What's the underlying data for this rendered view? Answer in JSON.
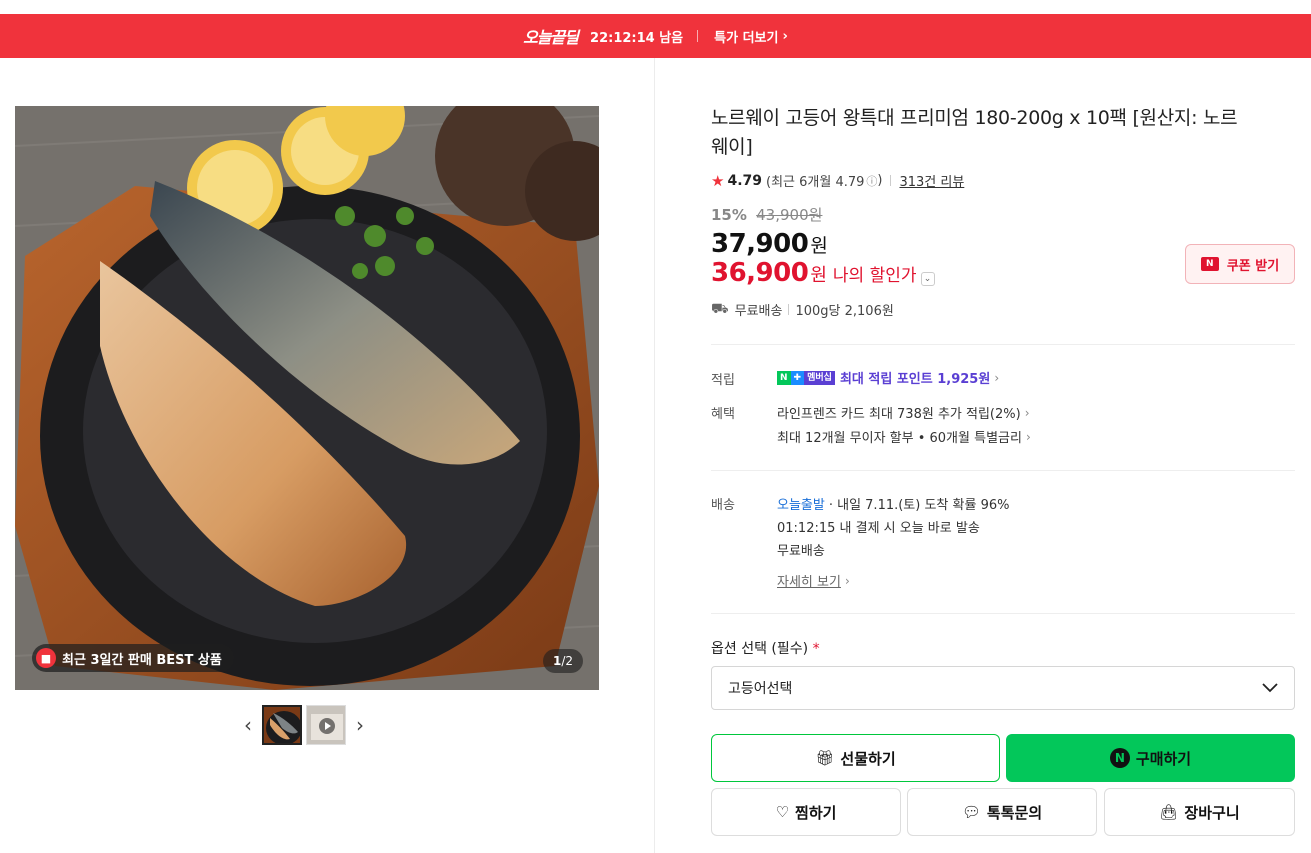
{
  "deal_bar": {
    "logo": "오늘끝딜",
    "timer": "22:12:14 남음",
    "more_label": "특가 더보기",
    "color": "#f0333c"
  },
  "gallery": {
    "best_badge": "최근 3일간 판매 BEST 상품",
    "counter_current": "1",
    "counter_total": "/2",
    "image_alt": "grilled-mackerel-on-cast-iron-plate"
  },
  "product": {
    "title": "노르웨이 고등어 왕특대 프리미엄 180-200g x 10팩 [원산지: 노르웨이]",
    "rating": "4.79",
    "rating_recent": "(최근 6개월 4.79",
    "rating_recent_close": ")",
    "review_count": "313건 리뷰",
    "discount_rate": "15%",
    "original_price": "43,900원",
    "price": "37,900",
    "price_unit": "원",
    "my_price": "36,900",
    "my_price_unit": "원",
    "my_price_label": "나의 할인가",
    "coupon_label": "쿠폰 받기",
    "shipping": "무료배송",
    "unit_price": "100g당 2,106원"
  },
  "benefits": {
    "points_label": "적립",
    "points_badge_n": "N",
    "points_badge_plus": "✚",
    "points_badge_member": "멤버십",
    "points_text": "최대 적립 포인트 1,925원",
    "benefit_label": "혜택",
    "benefit_1": "라인프렌즈 카드 최대 738원 추가 적립(2%)",
    "benefit_2": "최대 12개월 무이자 할부 • 60개월 특별금리"
  },
  "delivery": {
    "label": "배송",
    "today": "오늘출발",
    "arrival": "· 내일 7.11.(토) 도착 확률 96%",
    "cutoff": "01:12:15  내 결제 시 오늘 바로 발송",
    "fee": "무료배송",
    "detail_link": "자세히 보기"
  },
  "options": {
    "label": "옵션 선택 (필수)",
    "required_mark": "*",
    "selected": "고등어선택"
  },
  "actions": {
    "gift": "선물하기",
    "buy": "구매하기",
    "wish": "찜하기",
    "talk": "톡톡문의",
    "cart": "장바구니"
  },
  "colors": {
    "accent_red": "#e0132f",
    "naver_green": "#03c75a",
    "point_purple": "#5a3fd3"
  }
}
